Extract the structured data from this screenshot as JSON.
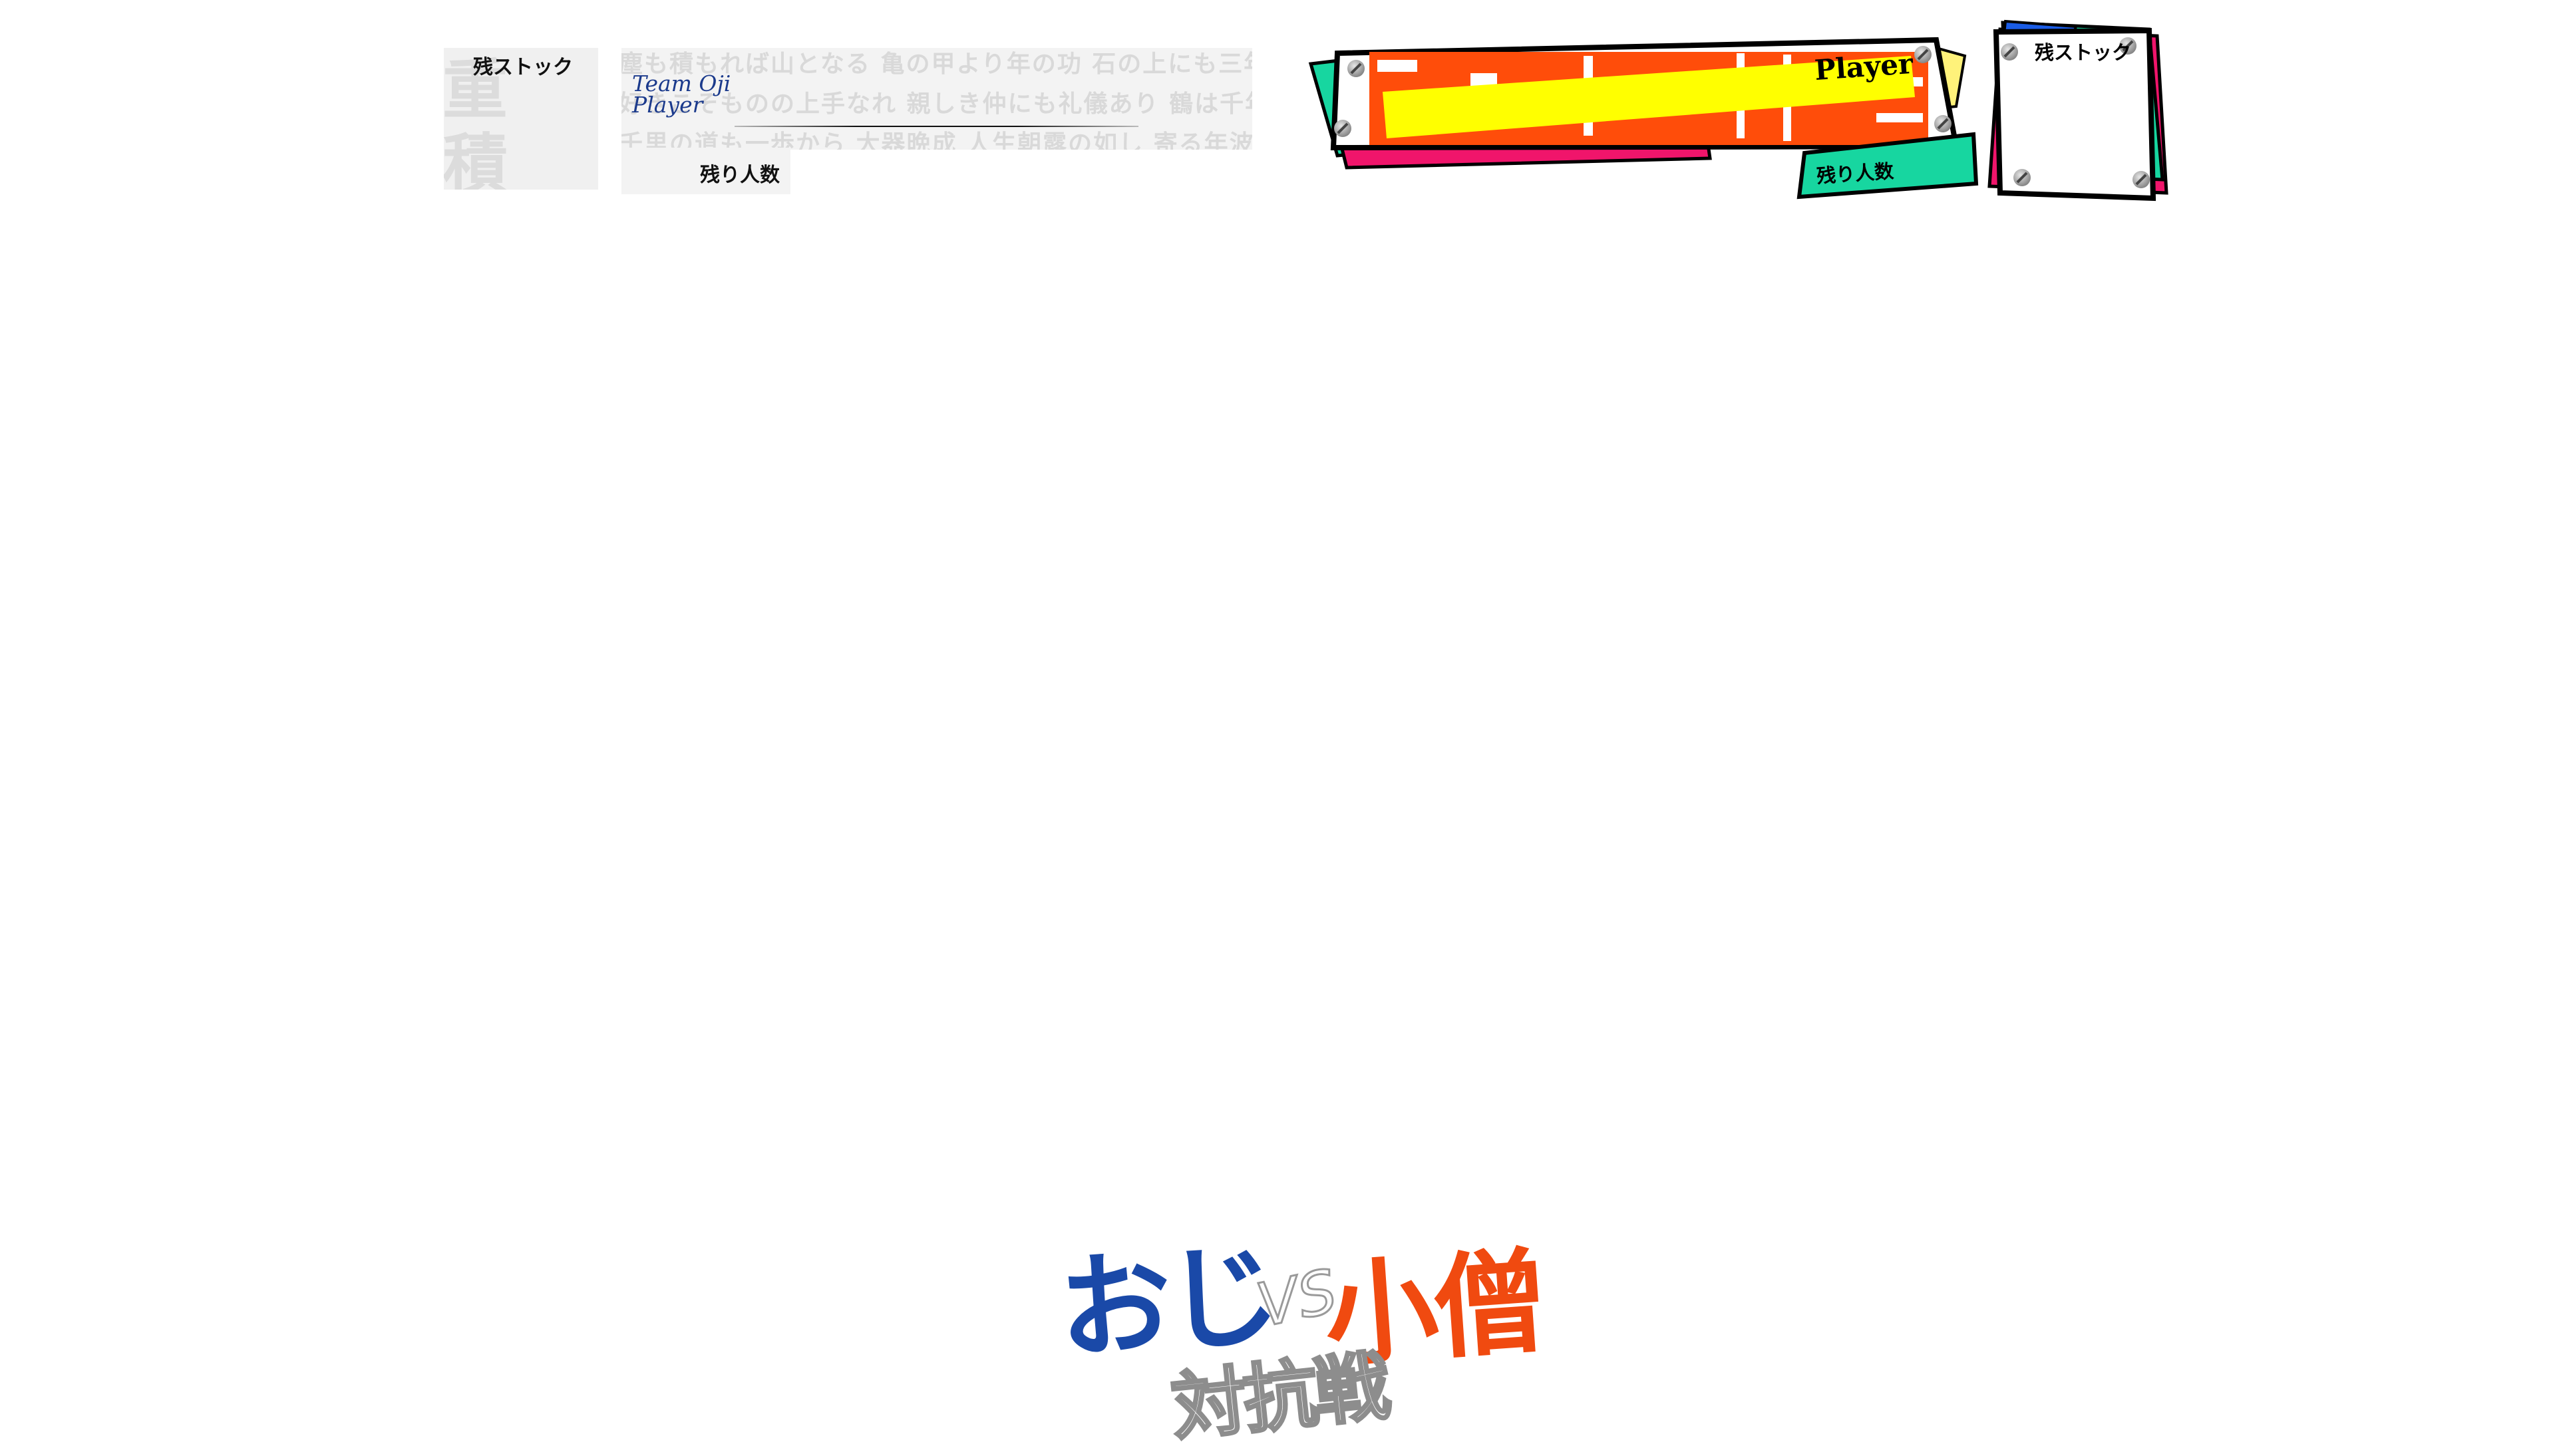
{
  "oji_hud": {
    "stock_label": "残ストック",
    "stock_watermark": "重 積\nねみ",
    "proverb_lines": [
      "塵も積もれば山となる 亀の甲より年の功 石の上にも三年 継続は力なり",
      "好きこそものの上手なれ 親しき仲にも礼儀あり 鶴は千年、亀は万年",
      "千里の道も一歩から 大器晩成 人生朝露の如し 寄る年波には勝てぬ"
    ],
    "team_name": "Team Oji",
    "player_label": "Player",
    "remaining_count_label": "残り人数",
    "text_color": "#1b3a8c",
    "panel_color": "#f0f0f0"
  },
  "kozo_hud": {
    "player_label": "Player",
    "remaining_count_label": "残り人数",
    "stock_label": "残ストック",
    "colors": {
      "teal": "#17d6a0",
      "pink": "#f0156b",
      "yellow": "#ffff00",
      "pale_yellow": "#fff27a",
      "orange": "#ff4d0a",
      "blue": "#1a5ce6",
      "outline": "#000000"
    }
  },
  "logo": {
    "part_left": "おじ",
    "part_vs": "VS",
    "part_right": "小僧",
    "subtitle": "対抗戦",
    "colors": {
      "oji": "#1a49a8",
      "kozo": "#f04a10"
    }
  }
}
